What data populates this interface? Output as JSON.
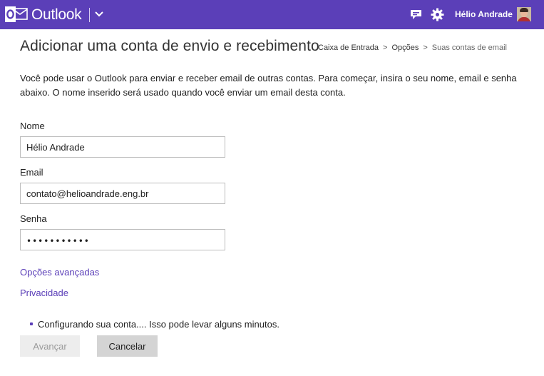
{
  "topbar": {
    "brand": "Outlook",
    "user_name": "Hélio Andrade",
    "icons": [
      "outlook-logo-icon",
      "chevron-down-icon",
      "feedback-icon",
      "gear-icon"
    ],
    "background_color": "#5b3fb8"
  },
  "page": {
    "title": "Adicionar uma conta de envio e recebimento",
    "breadcrumb": {
      "items": [
        "Caixa de Entrada",
        "Opções"
      ],
      "separator": ">",
      "current": "Suas contas de email"
    },
    "intro": "Você pode usar o Outlook para enviar e receber email de outras contas. Para começar, insira o seu nome, email e senha abaixo. O nome inserido será usado quando você enviar um email desta conta."
  },
  "form": {
    "name_label": "Nome",
    "name_value": "Hélio Andrade",
    "email_label": "Email",
    "email_value": "contato@helioandrade.eng.br",
    "password_label": "Senha",
    "password_mask": "•••••••••••"
  },
  "links": {
    "advanced": "Opções avançadas",
    "privacy": "Privacidade"
  },
  "status": {
    "message": "Configurando sua conta.... Isso pode levar alguns minutos."
  },
  "buttons": {
    "next": "Avançar",
    "cancel": "Cancelar"
  }
}
